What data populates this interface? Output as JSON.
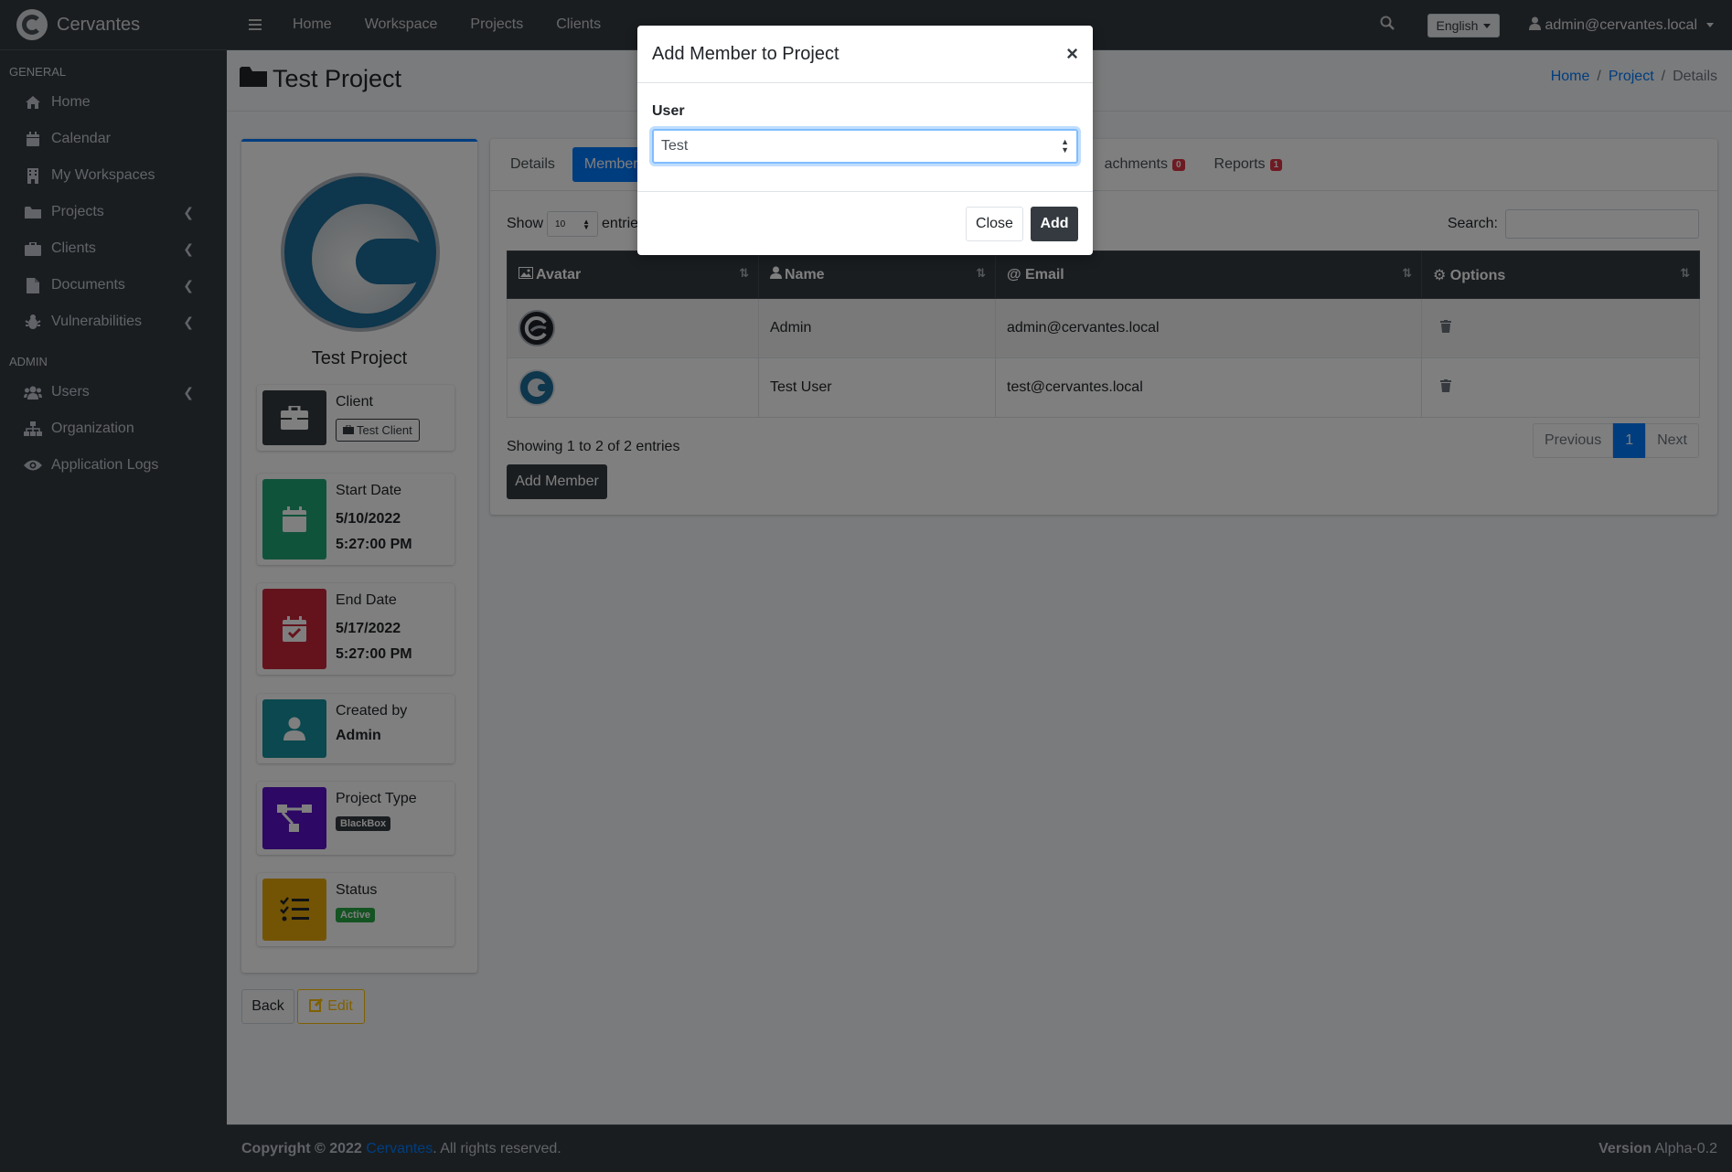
{
  "brand": {
    "name": "Cervantes"
  },
  "sidebar": {
    "sections": [
      {
        "header": "GENERAL",
        "items": [
          {
            "label": "Home",
            "icon": "home-icon"
          },
          {
            "label": "Calendar",
            "icon": "calendar-icon"
          },
          {
            "label": "My Workspaces",
            "icon": "building-icon"
          },
          {
            "label": "Projects",
            "icon": "folder-icon",
            "expandable": true
          },
          {
            "label": "Clients",
            "icon": "briefcase-icon",
            "expandable": true
          },
          {
            "label": "Documents",
            "icon": "file-icon",
            "expandable": true
          },
          {
            "label": "Vulnerabilities",
            "icon": "bug-icon",
            "expandable": true
          }
        ]
      },
      {
        "header": "ADMIN",
        "items": [
          {
            "label": "Users",
            "icon": "users-icon",
            "expandable": true
          },
          {
            "label": "Organization",
            "icon": "sitemap-icon"
          },
          {
            "label": "Application Logs",
            "icon": "eye-icon"
          }
        ]
      }
    ]
  },
  "topbar": {
    "links": [
      "Home",
      "Workspace",
      "Projects",
      "Clients"
    ],
    "language": "English",
    "user": "admin@cervantes.local"
  },
  "page": {
    "title": "Test Project",
    "breadcrumb": {
      "home": "Home",
      "project": "Project",
      "current": "Details"
    }
  },
  "profile": {
    "name": "Test Project",
    "client_label": "Client",
    "client_value": "Test Client",
    "start_label": "Start Date",
    "start_date": "5/10/2022",
    "start_time": "5:27:00 PM",
    "end_label": "End Date",
    "end_date": "5/17/2022",
    "end_time": "5:27:00 PM",
    "created_label": "Created by",
    "created_value": "Admin",
    "type_label": "Project Type",
    "type_value": "BlackBox",
    "status_label": "Status",
    "status_value": "Active",
    "colors": {
      "client": "#343a40",
      "start": "#20a777",
      "end": "#c9263a",
      "created": "#17909f",
      "type": "#5a11c9",
      "status": "#e6a808"
    }
  },
  "actions": {
    "back": "Back",
    "edit": "Edit"
  },
  "tabs": {
    "items": [
      {
        "label": "Details"
      },
      {
        "label": "Members"
      },
      {
        "label": "achments",
        "badge": "0"
      },
      {
        "label": "Reports",
        "badge": "1"
      }
    ]
  },
  "table": {
    "show_label": "Show",
    "length": "10",
    "entries_label": "entries",
    "search_label": "Search:",
    "columns": [
      "Avatar",
      "Name",
      "Email",
      "Options"
    ],
    "rows": [
      {
        "name": "Admin",
        "email": "admin@cervantes.local"
      },
      {
        "name": "Test User",
        "email": "test@cervantes.local"
      }
    ],
    "info": "Showing 1 to 2 of 2 entries",
    "pager": {
      "previous": "Previous",
      "current": "1",
      "next": "Next"
    },
    "add_member": "Add Member"
  },
  "footer": {
    "copyright": "Copyright © 2022",
    "brand": "Cervantes",
    "rights": ". All rights reserved.",
    "version_label": "Version",
    "version": "Alpha-0.2"
  },
  "modal": {
    "title": "Add Member to Project",
    "close_x": "×",
    "user_label": "User",
    "user_value": "Test",
    "close": "Close",
    "add": "Add"
  }
}
